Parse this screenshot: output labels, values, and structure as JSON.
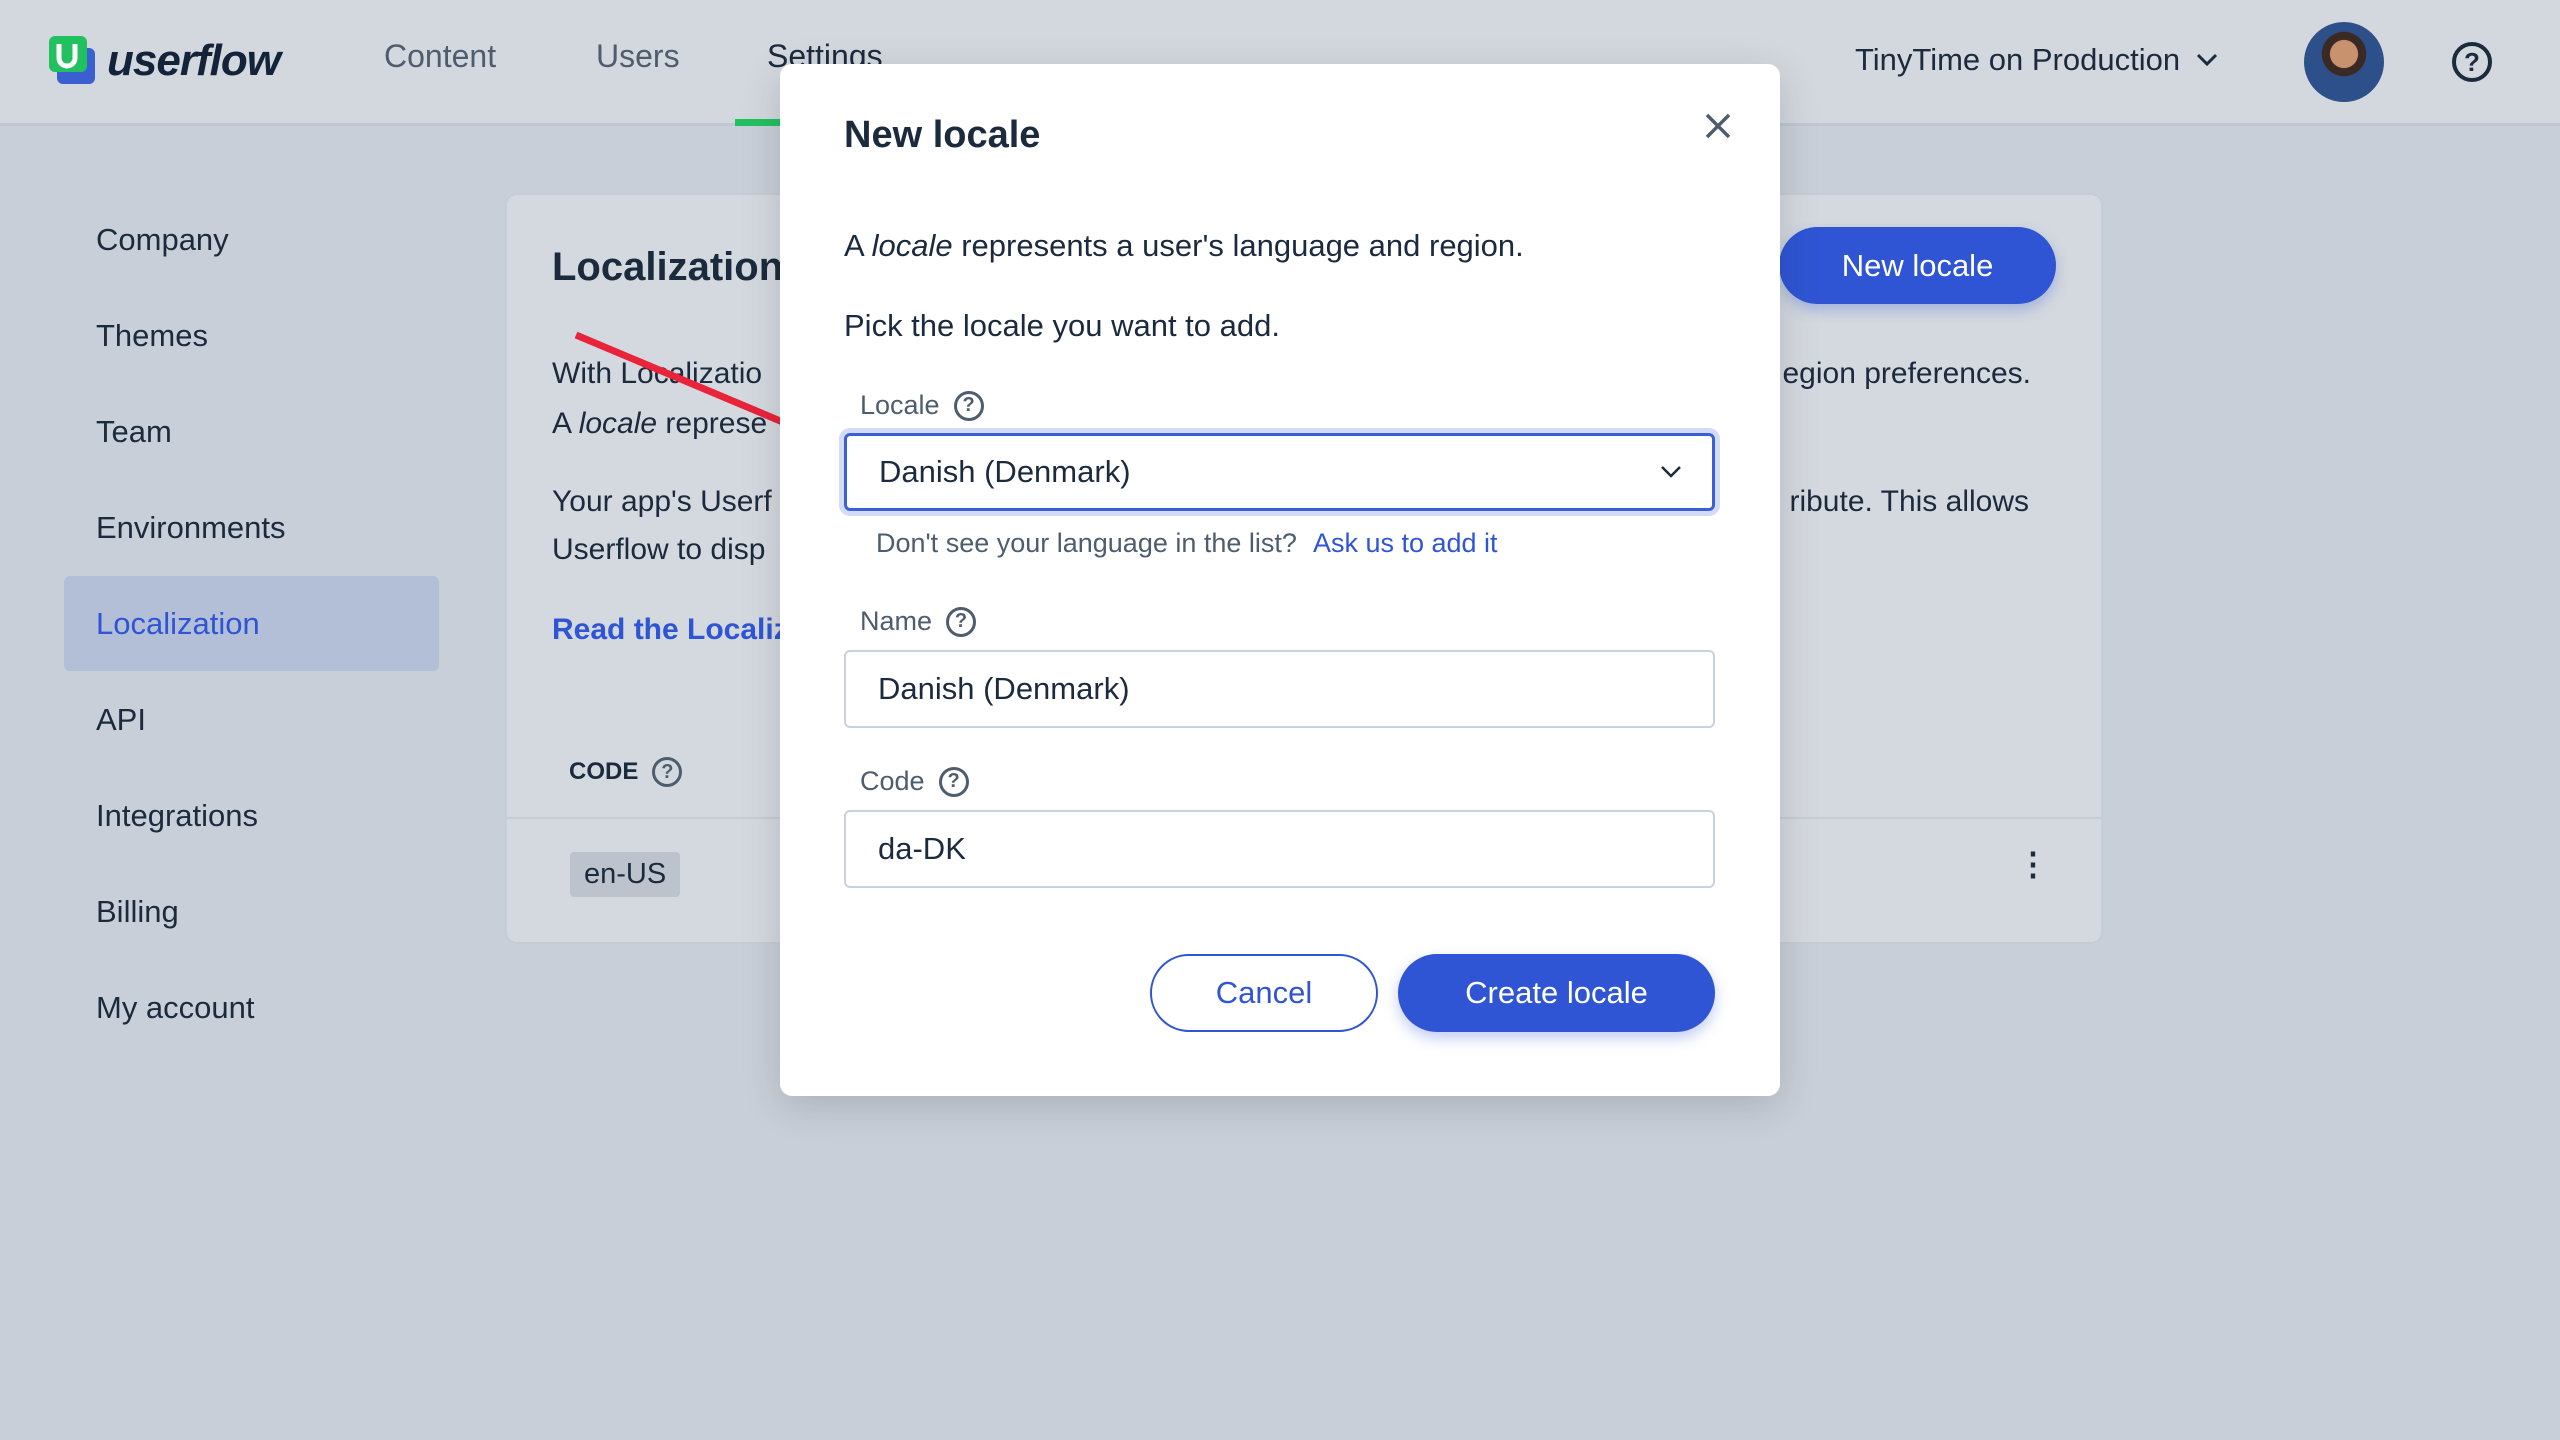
{
  "header": {
    "brand": "userflow",
    "nav": [
      "Content",
      "Users",
      "Settings"
    ],
    "active_nav": "Settings",
    "environment": "TinyTime on Production",
    "accent": "#22c160"
  },
  "sidebar": {
    "items": [
      "Company",
      "Themes",
      "Team",
      "Environments",
      "Localization",
      "API",
      "Integrations",
      "Billing",
      "My account"
    ],
    "active": "Localization"
  },
  "card": {
    "title": "Localization",
    "new_locale_button": "New locale",
    "line1_left": "With Localizatio",
    "line1_right": "egion preferences.",
    "line2_left_prefix": "A ",
    "line2_left_em": "locale",
    "line2_left_rest": " represe",
    "line3_left": "Your app's Userf",
    "line3_right": "ribute. This allows",
    "line4_left": "Userflow to disp",
    "link": "Read the Localiz",
    "column_code": "CODE",
    "rows": [
      {
        "code": "en-US"
      }
    ]
  },
  "modal": {
    "title": "New locale",
    "intro_prefix": "A ",
    "intro_em": "locale",
    "intro_rest": " represents a user's language and region.",
    "pick": "Pick the locale you want to add.",
    "locale_label": "Locale",
    "locale_value": "Danish (Denmark)",
    "hint": "Don't see your language in the list?",
    "hint_link": "Ask us to add it",
    "name_label": "Name",
    "name_value": "Danish (Denmark)",
    "code_label": "Code",
    "code_value": "da-DK",
    "cancel": "Cancel",
    "create": "Create locale",
    "primary_color": "#2f55d4"
  }
}
